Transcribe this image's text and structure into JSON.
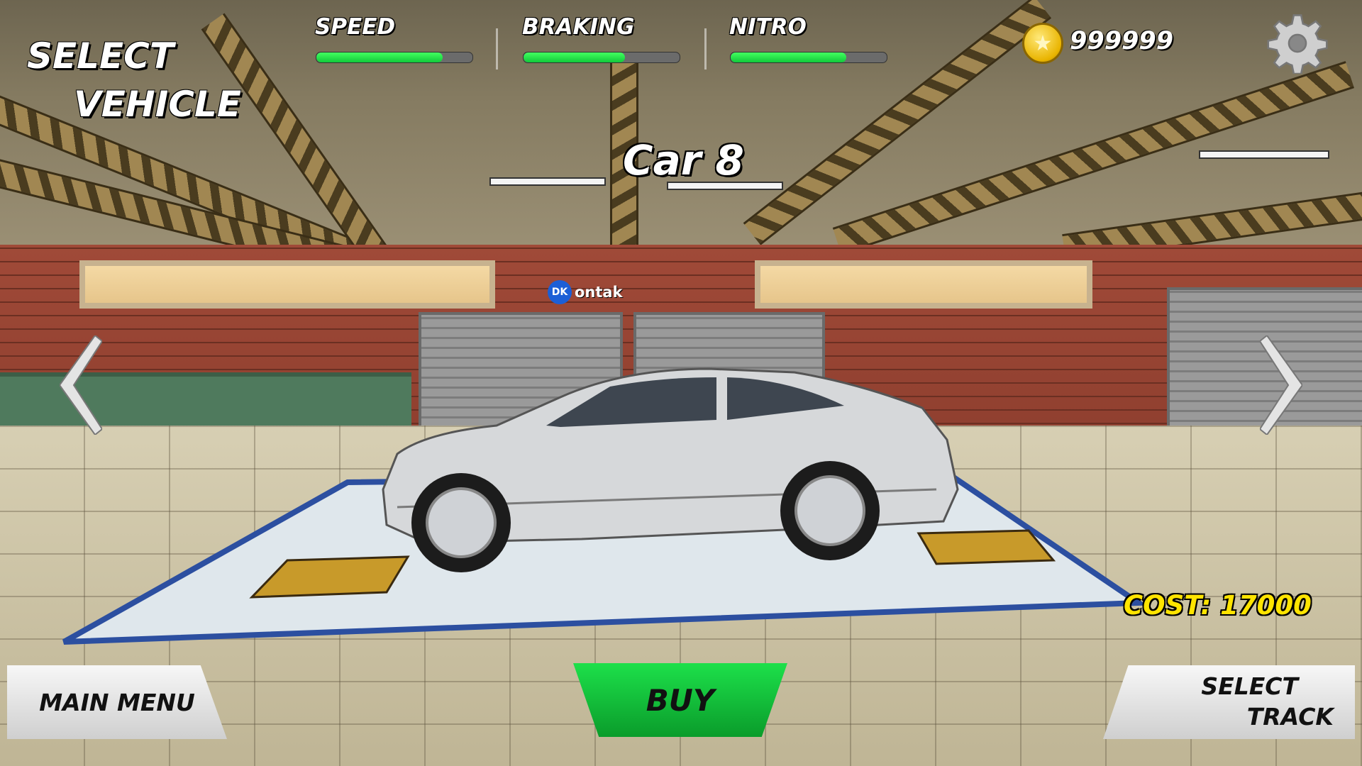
{
  "screen": {
    "title_line1": "SELECT",
    "title_line2": "VEHICLE",
    "car_name": "Car 8",
    "watermark": "ontak",
    "watermark_badge": "DK"
  },
  "stats": [
    {
      "label": "SPEED",
      "value": 0.81
    },
    {
      "label": "BRAKING",
      "value": 0.65
    },
    {
      "label": "NITRO",
      "value": 0.74
    }
  ],
  "currency": {
    "icon": "star-coin-icon",
    "amount": "999999"
  },
  "cost": "COST: 17000",
  "buttons": {
    "main_menu": "MAIN MENU",
    "buy": "BUY",
    "select_track_line1": "SELECT",
    "select_track_line2": "TRACK"
  },
  "colors": {
    "stat_fill": "#22e04a",
    "buy_button": "#11c93a",
    "cost_text": "#ffe400",
    "car_body": "#d8d8d8"
  },
  "icons": {
    "settings": "gear-icon",
    "prev": "chevron-left-icon",
    "next": "chevron-right-icon"
  }
}
